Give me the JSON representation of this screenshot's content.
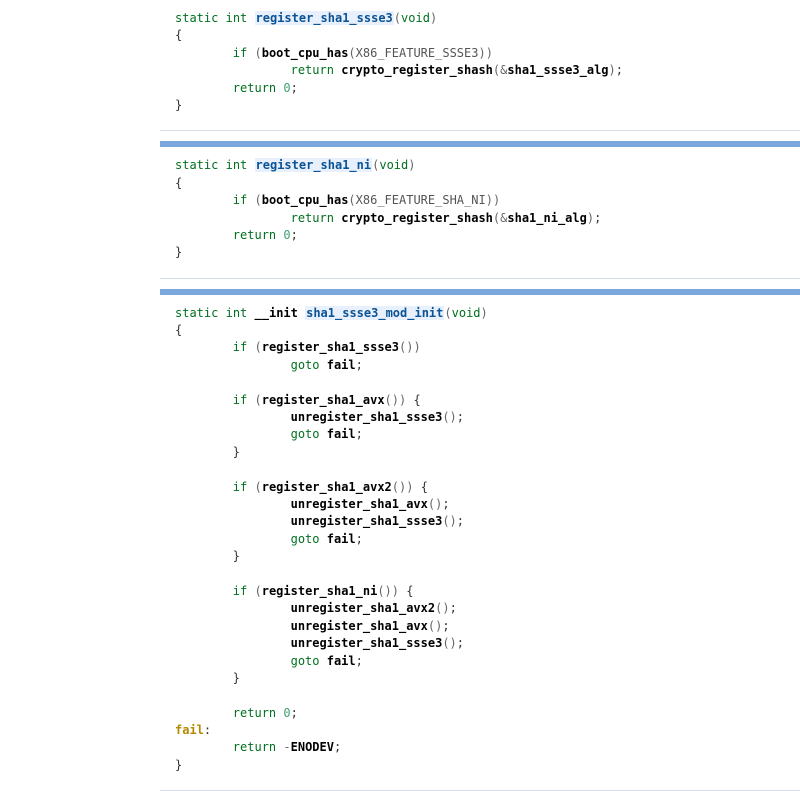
{
  "kw": {
    "static": "static",
    "int": "int",
    "void": "void",
    "if": "if",
    "return": "return",
    "goto": "goto",
    "init": "__init"
  },
  "fn": {
    "register_sha1_ssse3": "register_sha1_ssse3",
    "register_sha1_ni": "register_sha1_ni",
    "sha1_ssse3_mod_init": "sha1_ssse3_mod_init",
    "boot_cpu_has": "boot_cpu_has",
    "crypto_register_shash": "crypto_register_shash",
    "register_sha1_avx": "register_sha1_avx",
    "register_sha1_avx2": "register_sha1_avx2",
    "unregister_sha1_ssse3": "unregister_sha1_ssse3",
    "unregister_sha1_avx": "unregister_sha1_avx",
    "unregister_sha1_avx2": "unregister_sha1_avx2"
  },
  "const": {
    "X86_FEATURE_SSSE3": "X86_FEATURE_SSSE3",
    "X86_FEATURE_SHA_NI": "X86_FEATURE_SHA_NI",
    "ENODEV": "ENODEV"
  },
  "arg": {
    "sha1_ssse3_alg": "sha1_ssse3_alg",
    "sha1_ni_alg": "sha1_ni_alg"
  },
  "lit": {
    "zero": "0"
  },
  "label": {
    "fail": "fail"
  },
  "punct": {
    "lbrace": "{",
    "rbrace": "}",
    "lparen": "(",
    "rparen": ")",
    "semi": ";",
    "colon": ":",
    "amp": "&",
    "minus": "-"
  }
}
